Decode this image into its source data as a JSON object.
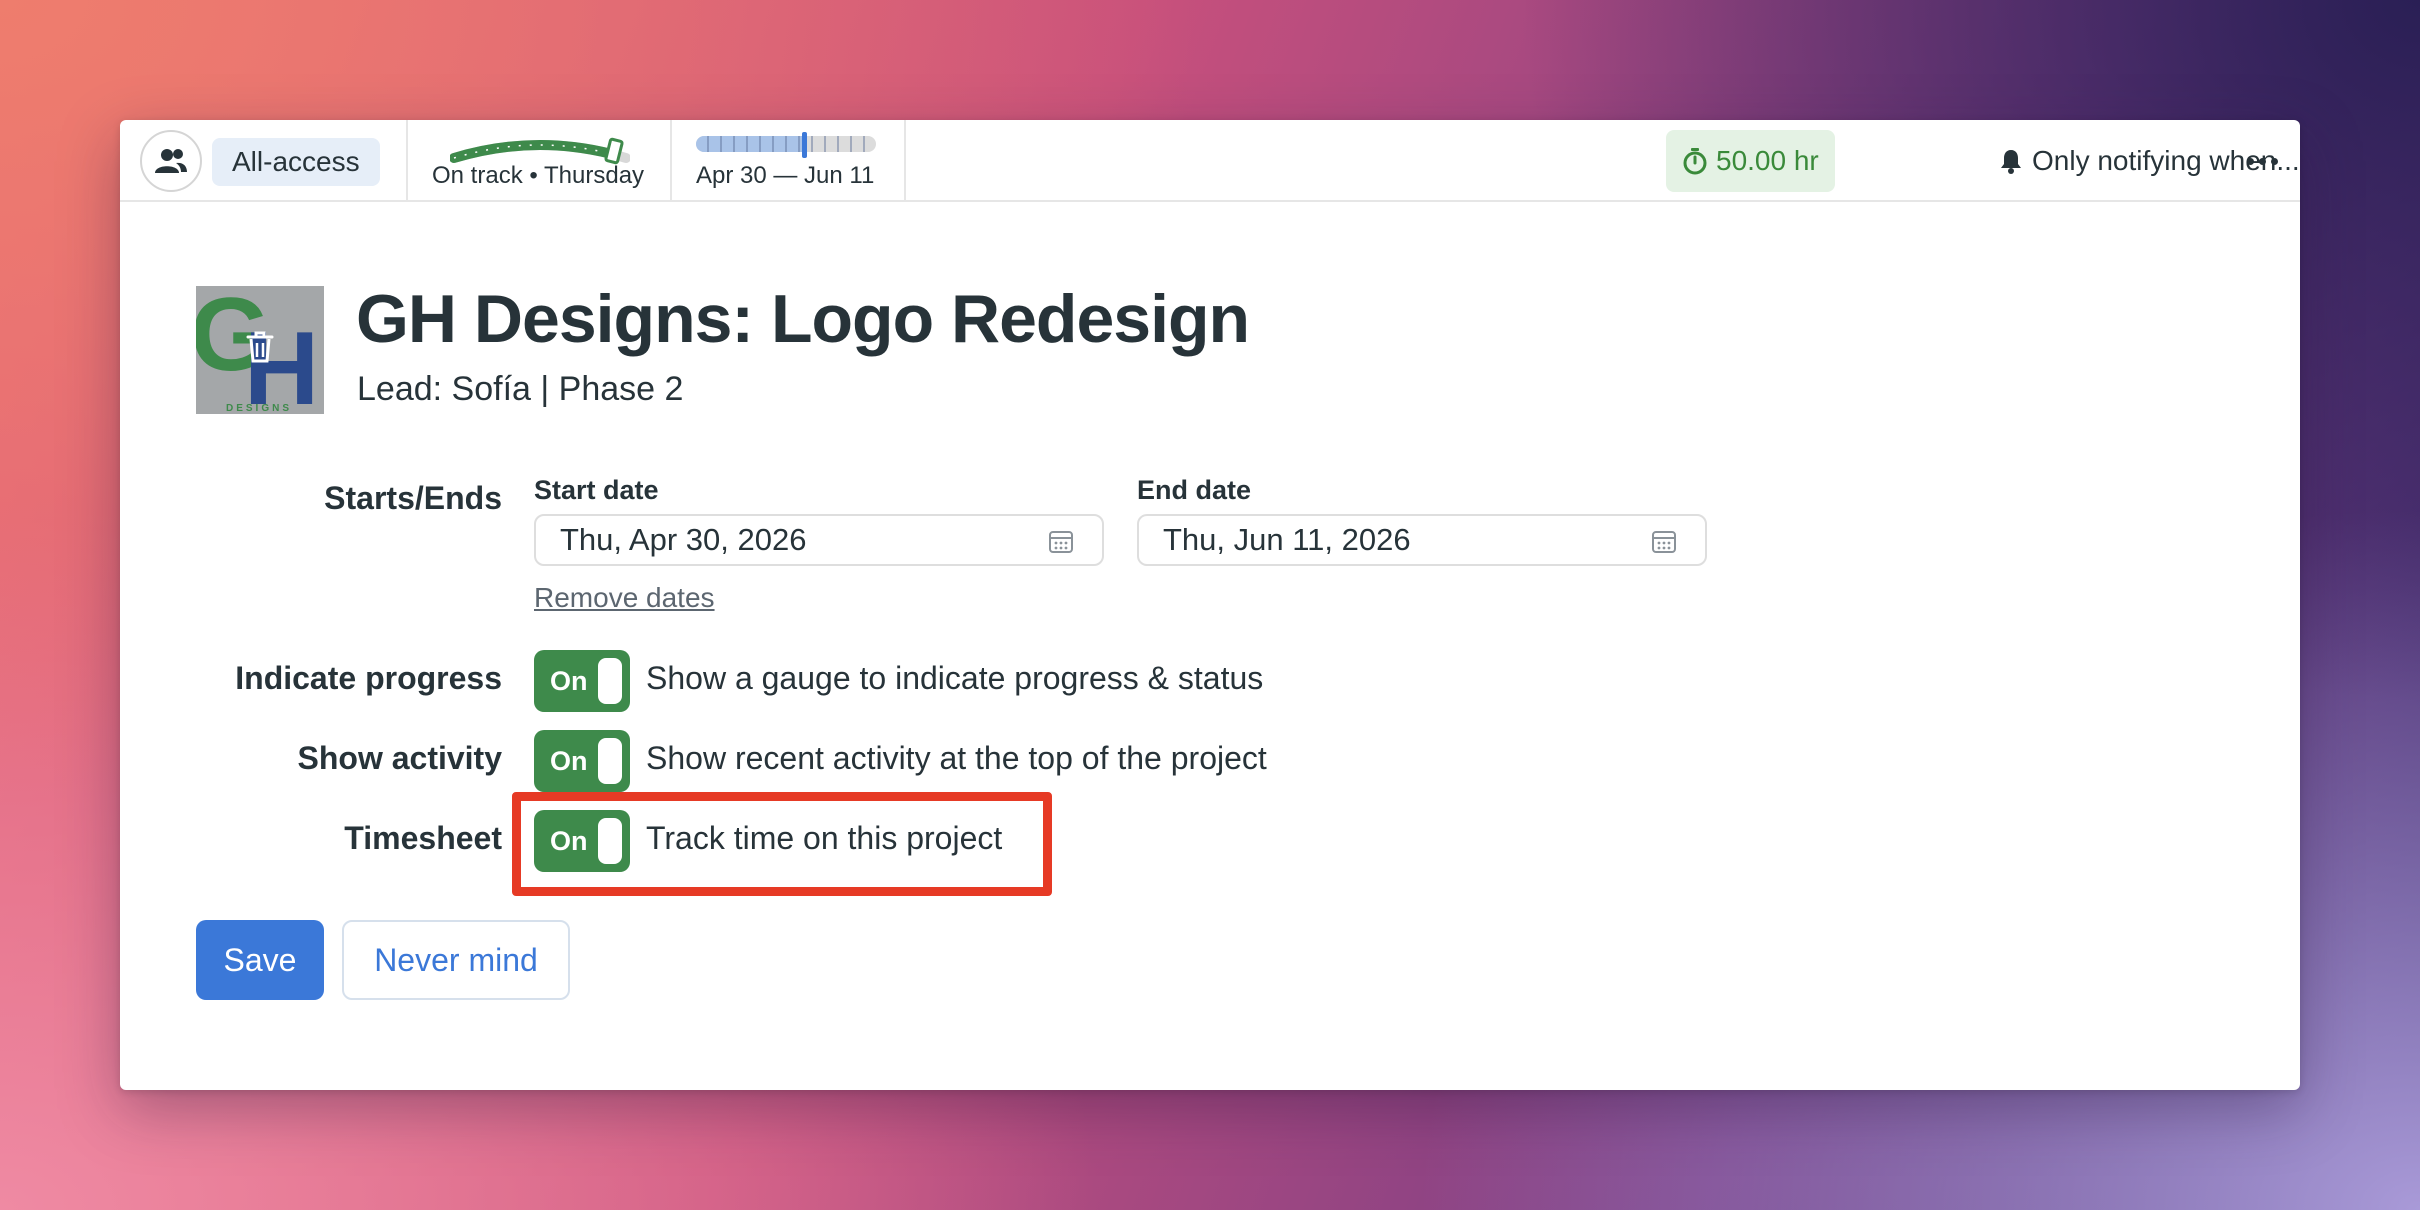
{
  "topbar": {
    "access_label": "All-access",
    "progress_caption": "On track • Thursday",
    "progress_value": 0.9,
    "dates_caption": "Apr 30 — Jun 11",
    "dates_elapsed_fraction": 0.6,
    "hours_label": "50.00 hr",
    "notify_label": "Only notifying when..."
  },
  "project": {
    "title": "GH Designs: Logo Redesign",
    "subtitle": "Lead: Sofía | Phase 2",
    "logo_text": "DESIGNS"
  },
  "form": {
    "dates_row_label": "Starts/Ends",
    "start_label": "Start date",
    "start_value": "Thu, Apr 30, 2026",
    "end_label": "End date",
    "end_value": "Thu, Jun 11, 2026",
    "remove_dates": "Remove dates",
    "progress_row_label": "Indicate progress",
    "progress_toggle": "On",
    "progress_desc": "Show a gauge to indicate progress & status",
    "activity_row_label": "Show activity",
    "activity_toggle": "On",
    "activity_desc": "Show recent activity at the top of the project",
    "timesheet_row_label": "Timesheet",
    "timesheet_toggle": "On",
    "timesheet_desc": "Track time on this project"
  },
  "actions": {
    "save": "Save",
    "cancel": "Never mind"
  },
  "colors": {
    "accent_blue": "#3b78d8",
    "toggle_green": "#3e8a4b",
    "highlight_red": "#e63a25",
    "hours_green": "#3a8a3a"
  }
}
